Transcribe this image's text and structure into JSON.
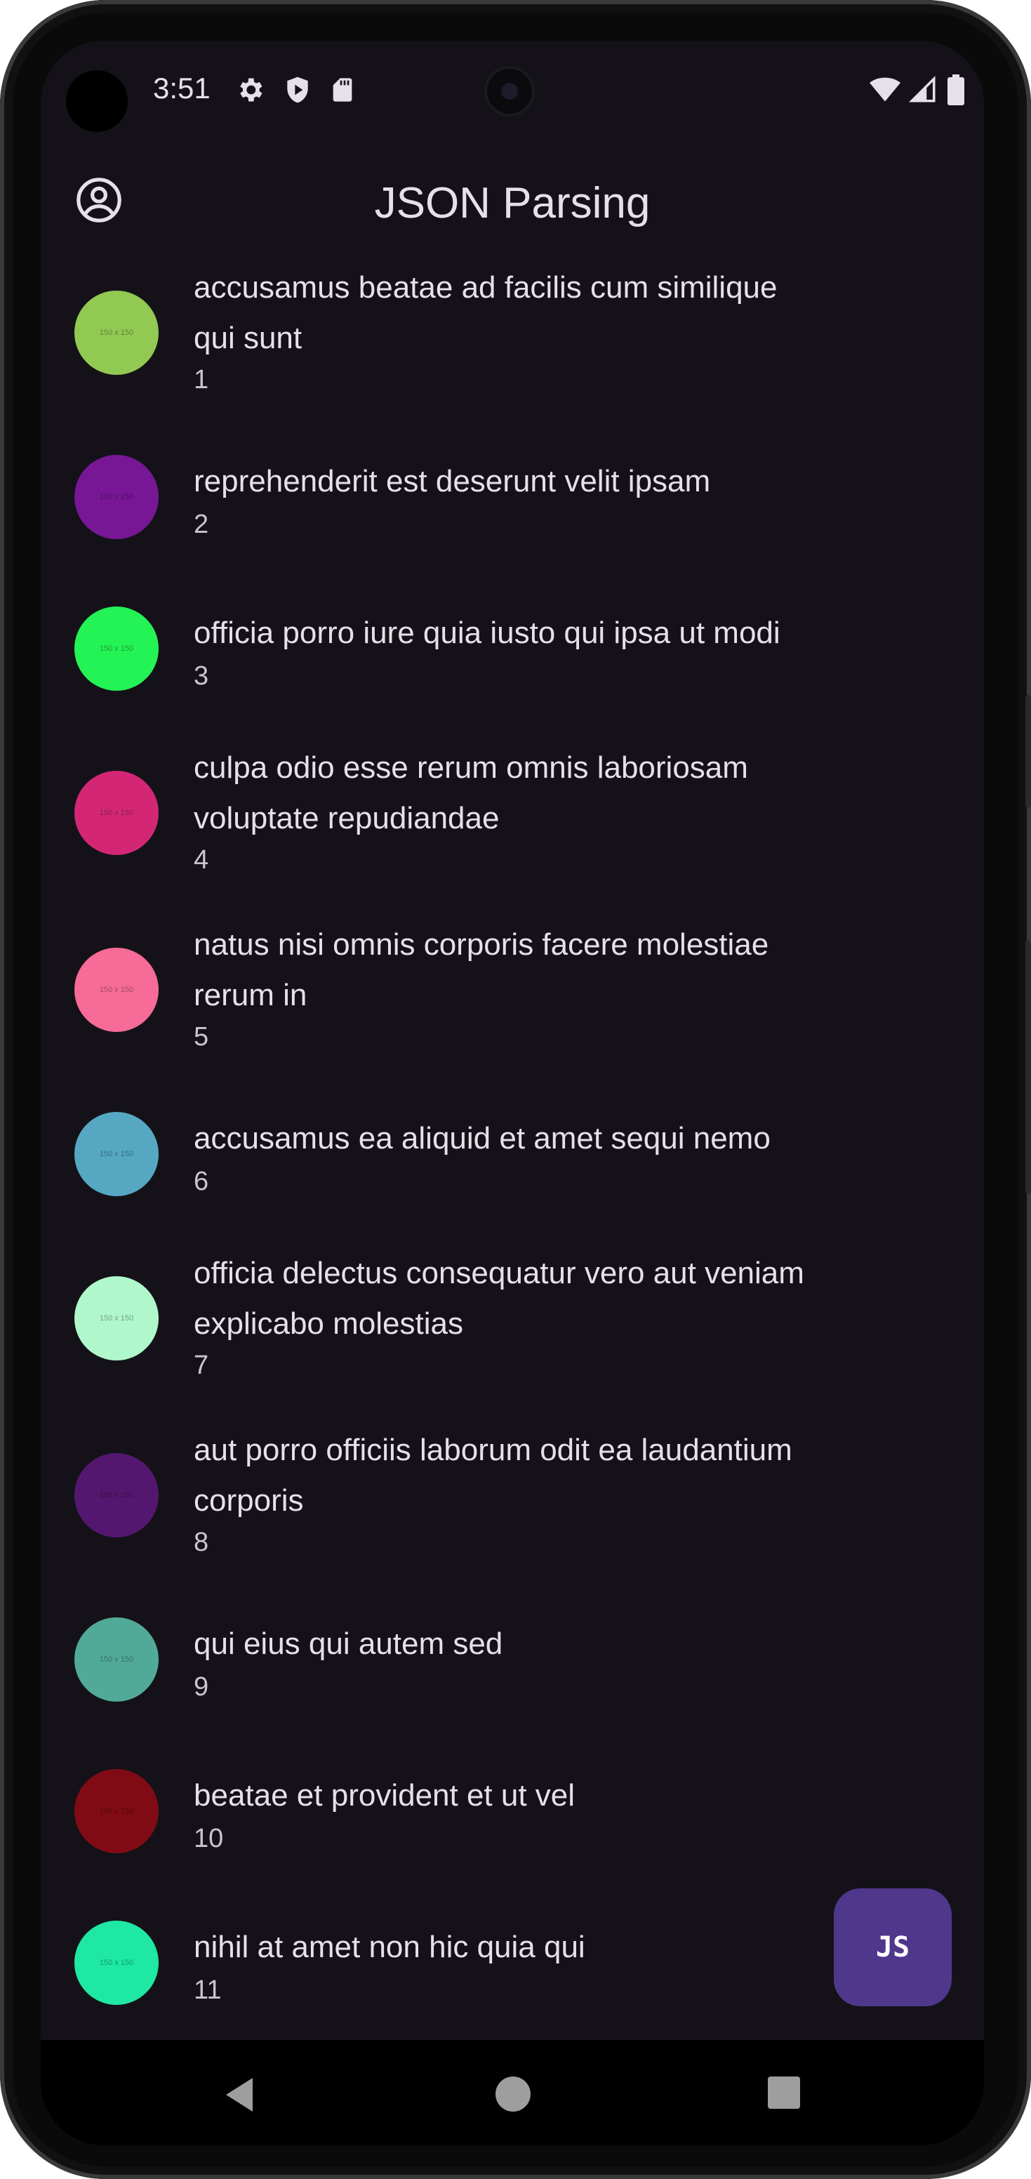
{
  "status": {
    "time": "3:51"
  },
  "app_bar": {
    "title": "JSON Parsing"
  },
  "items": [
    {
      "title_lines": [
        "accusamus beatae ad facilis cum similique",
        "qui sunt"
      ],
      "id": "1",
      "color": "#92c952",
      "placeholder": "150 x 150"
    },
    {
      "title_lines": [
        "reprehenderit est deserunt velit ipsam"
      ],
      "id": "2",
      "color": "#771796",
      "placeholder": "150 x 150"
    },
    {
      "title_lines": [
        "officia porro iure quia iusto qui ipsa ut modi"
      ],
      "id": "3",
      "color": "#24f355",
      "placeholder": "150 x 150"
    },
    {
      "title_lines": [
        "culpa odio esse rerum omnis laboriosam",
        "voluptate repudiandae"
      ],
      "id": "4",
      "color": "#d32776",
      "placeholder": "150 x 150"
    },
    {
      "title_lines": [
        "natus nisi omnis corporis facere molestiae",
        "rerum in"
      ],
      "id": "5",
      "color": "#f66b97",
      "placeholder": "150 x 150"
    },
    {
      "title_lines": [
        "accusamus ea aliquid et amet sequi nemo"
      ],
      "id": "6",
      "color": "#56a8c2",
      "placeholder": "150 x 150"
    },
    {
      "title_lines": [
        "officia delectus consequatur vero aut veniam",
        "explicabo molestias"
      ],
      "id": "7",
      "color": "#b0f7cc",
      "placeholder": "150 x 150"
    },
    {
      "title_lines": [
        "aut porro officiis laborum odit ea laudantium",
        "corporis"
      ],
      "id": "8",
      "color": "#54176f",
      "placeholder": "150 x 150"
    },
    {
      "title_lines": [
        "qui eius qui autem sed"
      ],
      "id": "9",
      "color": "#51aa97",
      "placeholder": "150 x 150"
    },
    {
      "title_lines": [
        "beatae et provident et ut vel"
      ],
      "id": "10",
      "color": "#810b14",
      "placeholder": "150 x 150"
    },
    {
      "title_lines": [
        "nihil at amet non hic quia qui"
      ],
      "id": "11",
      "color": "#1ee8a4",
      "placeholder": "150 x 150"
    }
  ],
  "fab": {
    "label": "JS"
  }
}
